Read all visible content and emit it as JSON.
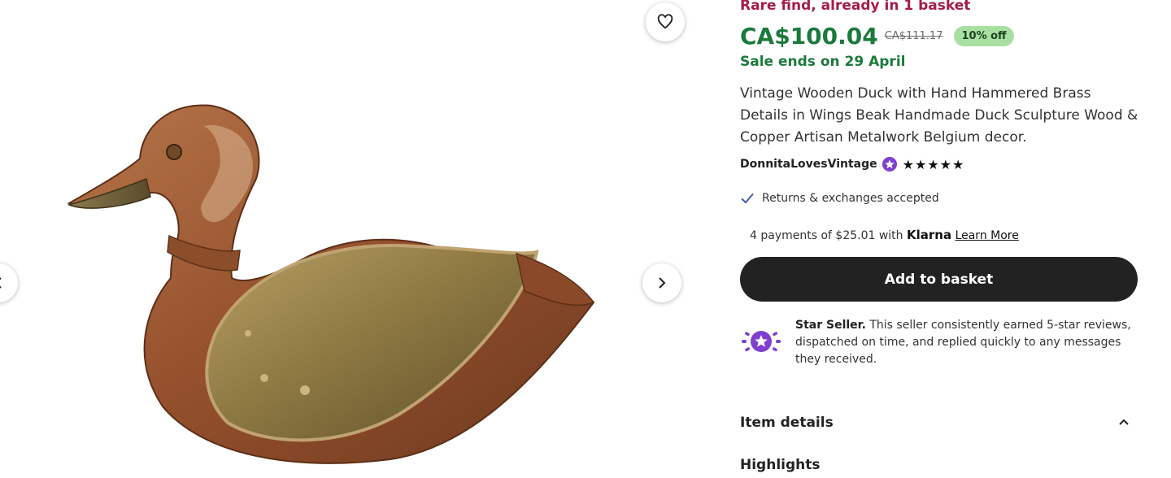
{
  "listing": {
    "rare_text": "Rare find, already in 1 basket",
    "price": "CA$100.04",
    "original_price": "CA$111.17",
    "discount_badge": "10% off",
    "sale_ends": "Sale ends on 29 April",
    "title": "Vintage Wooden Duck with Hand Hammered Brass Details in Wings Beak Handmade Duck Sculpture Wood & Copper Artisan Metalwork Belgium decor.",
    "seller": "DonnitaLovesVintage",
    "rating": 5,
    "returns": "Returns & exchanges accepted",
    "payments_text": "4 payments of $25.01 with",
    "payments_provider": "Klarna",
    "learn_more": "Learn More",
    "add_to_basket": "Add to basket",
    "star_seller_label": "Star Seller.",
    "star_seller_text": "This seller consistently earned 5-star reviews, dispatched on time, and replied quickly to any messages they received.",
    "item_details": "Item details",
    "highlights": "Highlights"
  },
  "icons": {
    "favorite": "heart-icon",
    "prev": "chevron-left-icon",
    "next": "chevron-right-icon",
    "check": "check-icon",
    "star_seller": "star-seller-badge-icon",
    "collapse": "chevron-up-icon"
  },
  "colors": {
    "rare": "#a61a4b",
    "price": "#1c7a3c",
    "badge_bg": "#a9e0a2",
    "button_bg": "#222222",
    "star_seller_purple": "#7f3fd1"
  }
}
